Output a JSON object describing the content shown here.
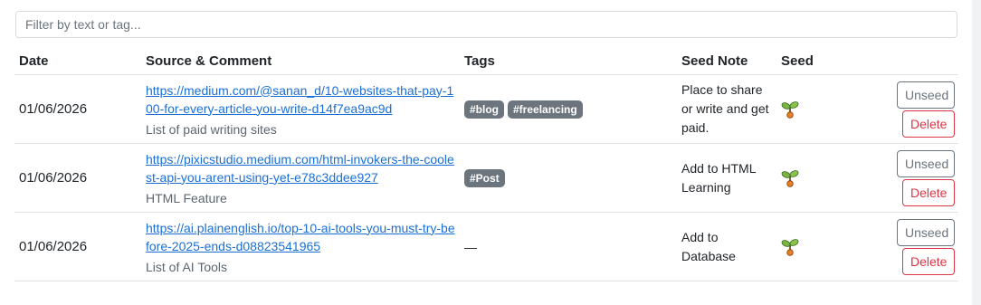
{
  "filter": {
    "placeholder": "Filter by text or tag..."
  },
  "table": {
    "headers": {
      "date": "Date",
      "source": "Source & Comment",
      "tags": "Tags",
      "note": "Seed Note",
      "seed": "Seed"
    },
    "rows": [
      {
        "date": "01/06/2026",
        "url": "https://medium.com/@sanan_d/10-websites-that-pay-100-for-every-article-you-write-d14f7ea9ac9d",
        "comment": "List of paid writing sites",
        "tags": [
          "#blog",
          "#freelancing"
        ],
        "note": "Place to share or write and get paid.",
        "seed_icon": "sprout-icon"
      },
      {
        "date": "01/06/2026",
        "url": "https://pixicstudio.medium.com/html-invokers-the-coolest-api-you-arent-using-yet-e78c3ddee927",
        "comment": "HTML Feature",
        "tags": [
          "#Post"
        ],
        "note": "Add to HTML Learning",
        "seed_icon": "sprout-icon"
      },
      {
        "date": "01/06/2026",
        "url": "https://ai.plainenglish.io/top-10-ai-tools-you-must-try-before-2025-ends-d08823541965",
        "comment": "List of AI Tools",
        "tags": [],
        "empty_tags": "—",
        "note": "Add to Database",
        "seed_icon": "sprout-icon"
      }
    ],
    "unseed_label": "Unseed",
    "delete_label": "Delete"
  },
  "colors": {
    "link": "#1a6fd6",
    "tag_bg": "#6c757d",
    "delete": "#dc3545",
    "unseed": "#6c757d"
  }
}
